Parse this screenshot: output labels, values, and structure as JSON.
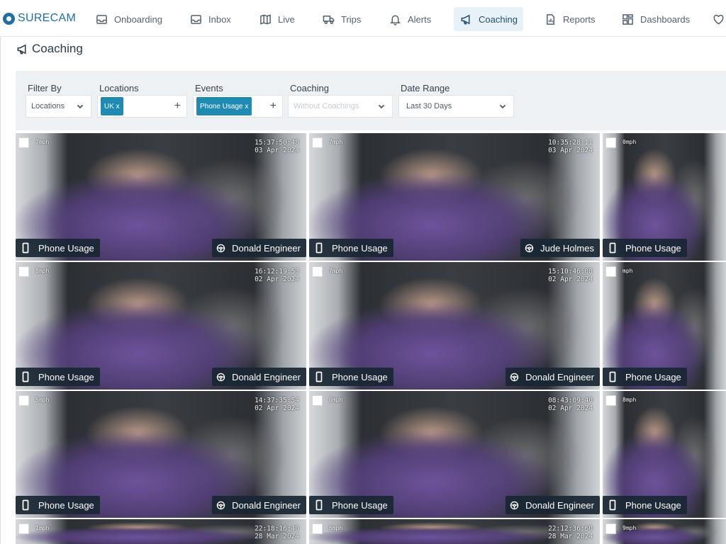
{
  "app": {
    "brand": "SURECAM"
  },
  "nav": [
    {
      "label": "Onboarding",
      "icon": "inbox-tray-icon",
      "active": false
    },
    {
      "label": "Inbox",
      "icon": "inbox-icon",
      "active": false
    },
    {
      "label": "Live",
      "icon": "map-icon",
      "active": false
    },
    {
      "label": "Trips",
      "icon": "truck-icon",
      "active": false
    },
    {
      "label": "Alerts",
      "icon": "bell-icon",
      "active": false
    },
    {
      "label": "Coaching",
      "icon": "megaphone-icon",
      "active": true
    },
    {
      "label": "Reports",
      "icon": "report-icon",
      "active": false
    },
    {
      "label": "Dashboards",
      "icon": "dashboard-icon",
      "active": false
    }
  ],
  "page": {
    "title": "Coaching"
  },
  "filters": {
    "filter_by": {
      "label": "Filter By",
      "value": "Locations"
    },
    "locations": {
      "label": "Locations",
      "tag": "UK x"
    },
    "events": {
      "label": "Events",
      "tag": "Phone Usage x"
    },
    "coaching": {
      "label": "Coaching",
      "placeholder": "Without Coachings"
    },
    "date_range": {
      "label": "Date Range",
      "value": "Last 30 Days"
    }
  },
  "clips": [
    {
      "speed": "7mph",
      "time": "15:37:50:48",
      "date": "03 Apr 2024",
      "event": "Phone Usage",
      "driver": "Donald Engineer"
    },
    {
      "speed": "7mph",
      "time": "10:35:28:11",
      "date": "03 Apr 2024",
      "event": "Phone Usage",
      "driver": "Jude Holmes"
    },
    {
      "speed": "0mph",
      "time": "",
      "date": "",
      "event": "Phone Usage",
      "driver": ""
    },
    {
      "speed": "8mph",
      "time": "16:12:19:53",
      "date": "02 Apr 2024",
      "event": "Phone Usage",
      "driver": "Donald Engineer"
    },
    {
      "speed": "7mph",
      "time": "15:10:46:08",
      "date": "02 Apr 2024",
      "event": "Phone Usage",
      "driver": "Donald Engineer"
    },
    {
      "speed": "mph",
      "time": "",
      "date": "",
      "event": "Phone Usage",
      "driver": ""
    },
    {
      "speed": "5mph",
      "time": "14:37:35:54",
      "date": "02 Apr 2024",
      "event": "Phone Usage",
      "driver": "Donald Engineer"
    },
    {
      "speed": "0mph",
      "time": "08:43:09:40",
      "date": "02 Apr 2024",
      "event": "Phone Usage",
      "driver": "Donald Engineer"
    },
    {
      "speed": "8mph",
      "time": "",
      "date": "",
      "event": "Phone Usage",
      "driver": ""
    },
    {
      "speed": "1mph",
      "time": "22:18:16:40",
      "date": "28 Mar 2024",
      "event": "",
      "driver": ""
    },
    {
      "speed": "6mph",
      "time": "22:12:36:60",
      "date": "28 Mar 2024",
      "event": "",
      "driver": ""
    },
    {
      "speed": "9mph",
      "time": "",
      "date": "",
      "event": "",
      "driver": ""
    }
  ]
}
